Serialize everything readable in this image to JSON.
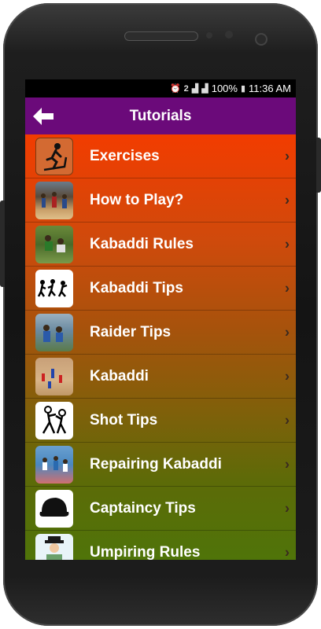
{
  "status": {
    "time": "11:36 AM",
    "battery": "100%",
    "icons": [
      "alarm-icon",
      "sim-icon",
      "signal-icon",
      "battery-icon"
    ]
  },
  "appbar": {
    "title": "Tutorials",
    "back_icon": "back-arrow-icon"
  },
  "items": [
    {
      "label": "Exercises",
      "icon": "treadmill-icon"
    },
    {
      "label": "How to Play?",
      "icon": "photo-thumbnail"
    },
    {
      "label": "Kabaddi Rules",
      "icon": "photo-thumbnail"
    },
    {
      "label": "Kabaddi Tips",
      "icon": "silhouette-icon"
    },
    {
      "label": "Raider Tips",
      "icon": "photo-thumbnail"
    },
    {
      "label": "Kabaddi",
      "icon": "photo-thumbnail"
    },
    {
      "label": "Shot Tips",
      "icon": "sketch-icon"
    },
    {
      "label": "Repairing Kabaddi",
      "icon": "photo-thumbnail"
    },
    {
      "label": "Captaincy Tips",
      "icon": "cap-icon"
    },
    {
      "label": "Umpiring Rules",
      "icon": "umpire-icon"
    }
  ],
  "colors": {
    "appbar": "#6b0a7a",
    "list_top": "#f23c00",
    "list_bottom": "#4f7409"
  }
}
